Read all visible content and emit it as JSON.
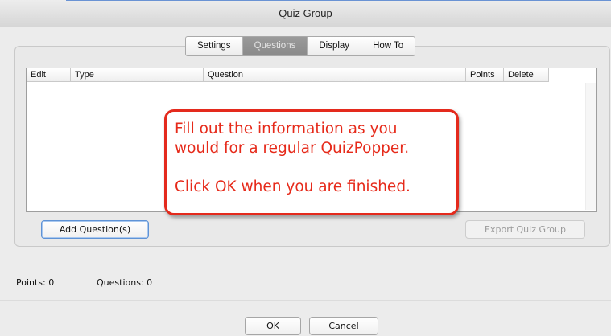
{
  "window": {
    "title": "Quiz Group"
  },
  "tabs": [
    {
      "label": "Settings",
      "active": false
    },
    {
      "label": "Questions",
      "active": true
    },
    {
      "label": "Display",
      "active": false
    },
    {
      "label": "How To",
      "active": false
    }
  ],
  "table": {
    "columns": [
      "Edit",
      "Type",
      "Question",
      "Points",
      "Delete"
    ],
    "rows": []
  },
  "callout": {
    "line1": "Fill out the information as you",
    "line2": "would for a regular QuizPopper.",
    "line3": "Click OK when you are finished.",
    "border_color": "#e42a1d",
    "text_color": "#e62a1a"
  },
  "buttons": {
    "add_question": "Add Question(s)",
    "export": "Export Quiz Group",
    "ok": "OK",
    "cancel": "Cancel"
  },
  "status": {
    "points_label": "Points:",
    "points_value": "0",
    "questions_label": "Questions:",
    "questions_value": "0"
  }
}
